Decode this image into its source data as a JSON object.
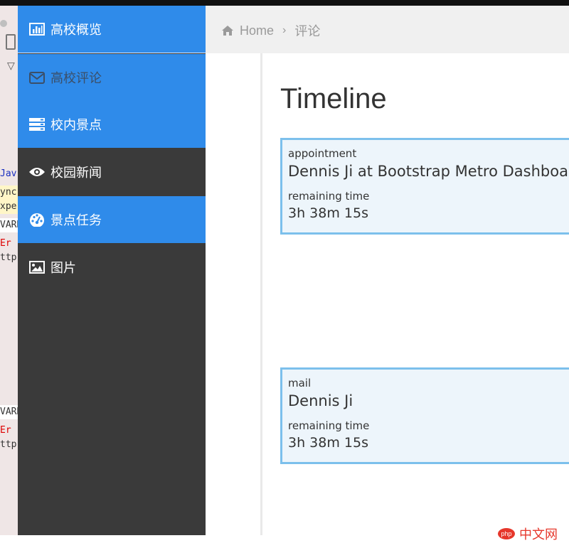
{
  "console_peek": {
    "lines": [
      "Jav.",
      "ync",
      "xpe",
      "VARN",
      "Er",
      "ttp",
      "VARN",
      "Er",
      "ttp"
    ]
  },
  "sidebar": {
    "items": [
      {
        "label": "高校概览",
        "icon": "bar-chart-icon"
      },
      {
        "label": "高校评论",
        "icon": "envelope-icon"
      },
      {
        "label": "校内景点",
        "icon": "server-icon"
      },
      {
        "label": "校园新闻",
        "icon": "eye-icon"
      },
      {
        "label": "景点任务",
        "icon": "dashboard-gauge-icon"
      },
      {
        "label": "图片",
        "icon": "picture-icon"
      }
    ]
  },
  "breadcrumb": {
    "home": "Home",
    "current": "评论"
  },
  "page": {
    "title": "Timeline"
  },
  "timeline": [
    {
      "type": "appointment",
      "title": "Dennis Ji at Bootstrap Metro Dashboard",
      "remaining_label": "remaining time",
      "remaining": "3h 38m 15s"
    },
    {
      "type": "mail",
      "title": "Dennis Ji",
      "remaining_label": "remaining time",
      "remaining": "3h 38m 15s"
    }
  ],
  "watermark": {
    "badge": "php",
    "text": "中文网"
  },
  "colors": {
    "sidebar_blue": "#2f8bea",
    "sidebar_dark": "#3a3a3a",
    "card_border": "#7cc0ec",
    "card_bg": "#edf5fb"
  }
}
